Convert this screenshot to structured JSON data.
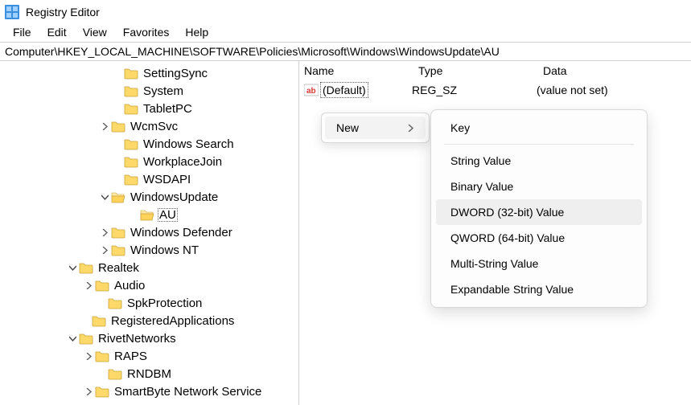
{
  "title": "Registry Editor",
  "menubar": {
    "file": "File",
    "edit": "Edit",
    "view": "View",
    "favorites": "Favorites",
    "help": "Help"
  },
  "address": "Computer\\HKEY_LOCAL_MACHINE\\SOFTWARE\\Policies\\Microsoft\\Windows\\WindowsUpdate\\AU",
  "tree": {
    "n0": "SettingSync",
    "n1": "System",
    "n2": "TabletPC",
    "n3": "WcmSvc",
    "n4": "Windows Search",
    "n5": "WorkplaceJoin",
    "n6": "WSDAPI",
    "n7": "WindowsUpdate",
    "n8": "AU",
    "n9": "Windows Defender",
    "n10": "Windows NT",
    "n11": "Realtek",
    "n12": "Audio",
    "n13": "SpkProtection",
    "n14": "RegisteredApplications",
    "n15": "RivetNetworks",
    "n16": "RAPS",
    "n17": "RNDBM",
    "n18": "SmartByte Network Service"
  },
  "list": {
    "cols": {
      "name": "Name",
      "type": "Type",
      "data": "Data"
    },
    "row0": {
      "name": "(Default)",
      "type": "REG_SZ",
      "data": "(value not set)"
    }
  },
  "context": {
    "new": "New",
    "items": {
      "key": "Key",
      "string": "String Value",
      "binary": "Binary Value",
      "dword": "DWORD (32-bit) Value",
      "qword": "QWORD (64-bit) Value",
      "multi": "Multi-String Value",
      "expand": "Expandable String Value"
    }
  }
}
